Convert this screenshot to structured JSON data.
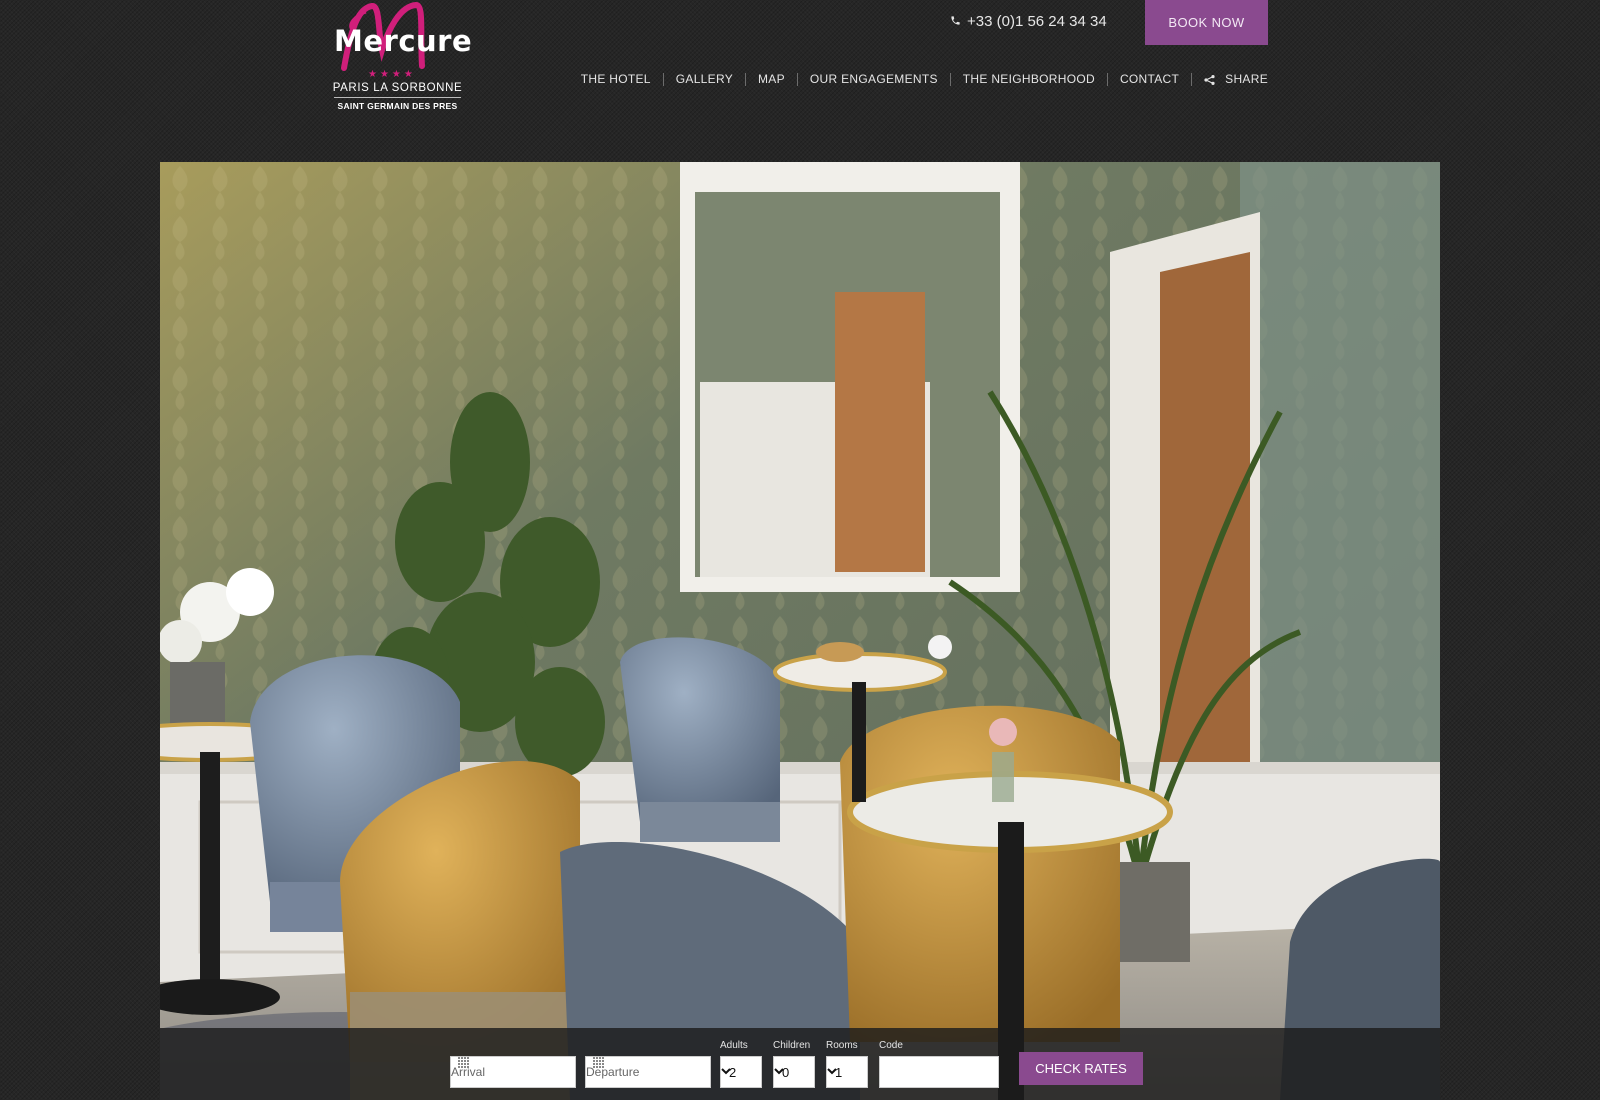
{
  "logo": {
    "brand": "Mercure",
    "stars": "★★★★",
    "line1": "PARIS LA SORBONNE",
    "line2": "SAINT GERMAIN DES PRES"
  },
  "header": {
    "phone": "+33 (0)1 56 24 34 34",
    "book_now": "BOOK NOW"
  },
  "nav": {
    "items": [
      "THE HOTEL",
      "GALLERY",
      "MAP",
      "OUR ENGAGEMENTS",
      "THE NEIGHBORHOOD",
      "CONTACT",
      "SHARE"
    ]
  },
  "booking": {
    "arrival_placeholder": "Arrival",
    "departure_placeholder": "Departure",
    "adults_label": "Adults",
    "adults_value": "2",
    "children_label": "Children",
    "children_value": "0",
    "rooms_label": "Rooms",
    "rooms_value": "1",
    "code_label": "Code",
    "code_value": "",
    "check_rates": "CHECK RATES"
  },
  "colors": {
    "accent": "#8a4a8f",
    "logo_pink": "#d01f7b",
    "background": "#262626"
  }
}
